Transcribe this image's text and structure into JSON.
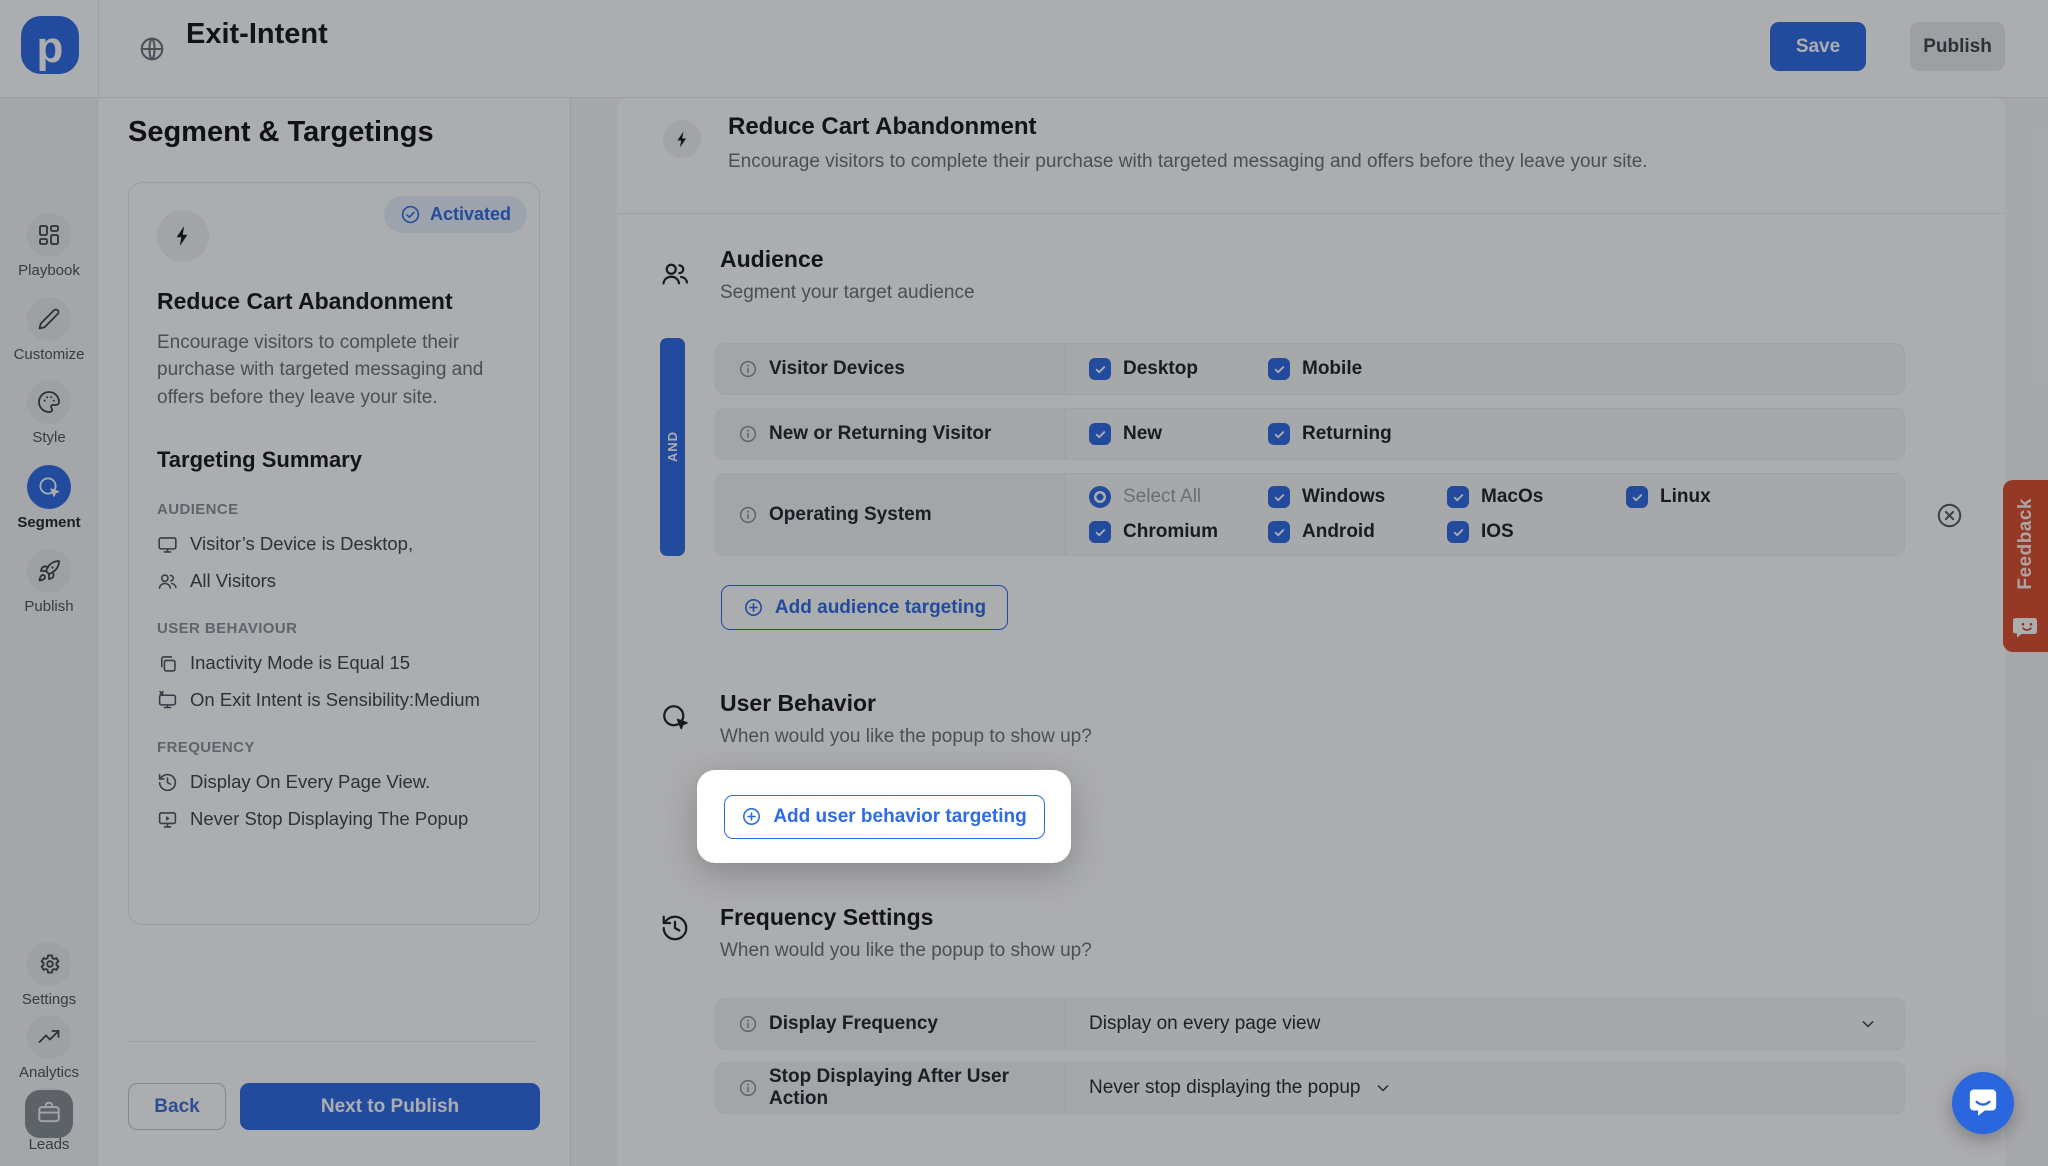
{
  "brand": {
    "logo_letter": "p"
  },
  "colors": {
    "accent": "#2E6BE5",
    "feedback_red": "#DE4E30",
    "page_bg": "#F7F8F9",
    "card_bg": "#FFFFFF"
  },
  "header": {
    "title": "Exit-Intent",
    "save_label": "Save",
    "publish_label": "Publish"
  },
  "sidebar": {
    "items": [
      {
        "label": "Playbook",
        "icon": "grid",
        "active": false
      },
      {
        "label": "Customize",
        "icon": "pencil",
        "active": false
      },
      {
        "label": "Style",
        "icon": "palette",
        "active": false
      },
      {
        "label": "Segment",
        "icon": "target",
        "active": true
      },
      {
        "label": "Publish",
        "icon": "rocket",
        "active": false
      },
      {
        "label": "Settings",
        "icon": "gear",
        "active": false
      },
      {
        "label": "Analytics",
        "icon": "trend",
        "active": false
      },
      {
        "label": "Leads",
        "icon": "users",
        "active": false
      }
    ]
  },
  "left_panel": {
    "title": "Segment & Targetings",
    "card": {
      "badge": "Activated",
      "title": "Reduce Cart Abandonment",
      "description": "Encourage visitors to complete their purchase with targeted messaging and offers before they leave your site.",
      "summary_title": "Targeting Summary",
      "sections": [
        {
          "label": "AUDIENCE",
          "items": [
            {
              "icon": "monitor",
              "text": "Visitor’s Device is Desktop,"
            },
            {
              "icon": "users",
              "text": "All Visitors"
            }
          ]
        },
        {
          "label": "USER BEHAVIOUR",
          "items": [
            {
              "icon": "copy",
              "text": "Inactivity Mode is Equal 15"
            },
            {
              "icon": "monitor-x",
              "text": "On Exit Intent is Sensibility:Medium"
            }
          ]
        },
        {
          "label": "FREQUENCY",
          "items": [
            {
              "icon": "history",
              "text": "Display On Every Page View."
            },
            {
              "icon": "monitor-play",
              "text": "Never Stop Displaying The Popup"
            }
          ]
        }
      ]
    },
    "back_label": "Back",
    "next_label": "Next to Publish"
  },
  "main": {
    "hero": {
      "title": "Reduce Cart Abandonment",
      "description": "Encourage visitors to complete their purchase with targeted messaging and offers before they leave your site."
    },
    "audience": {
      "title": "Audience",
      "subtitle": "Segment your target audience",
      "and_label": "AND",
      "add_button": "Add audience targeting",
      "rows": [
        {
          "label": "Visitor Devices",
          "tall": false,
          "option_lines": [
            [
              {
                "type": "checkbox",
                "checked": true,
                "label": "Desktop"
              },
              {
                "type": "checkbox",
                "checked": true,
                "label": "Mobile"
              }
            ]
          ]
        },
        {
          "label": "New or Returning Visitor",
          "tall": false,
          "option_lines": [
            [
              {
                "type": "checkbox",
                "checked": true,
                "label": "New"
              },
              {
                "type": "checkbox",
                "checked": true,
                "label": "Returning"
              }
            ]
          ]
        },
        {
          "label": "Operating System",
          "tall": true,
          "option_lines": [
            [
              {
                "type": "radio",
                "selected": true,
                "label": "Select All"
              },
              {
                "type": "checkbox",
                "checked": true,
                "label": "Windows"
              },
              {
                "type": "checkbox",
                "checked": true,
                "label": "MacOs"
              },
              {
                "type": "checkbox",
                "checked": true,
                "label": "Linux"
              }
            ],
            [
              {
                "type": "checkbox",
                "checked": true,
                "label": "Chromium"
              },
              {
                "type": "checkbox",
                "checked": true,
                "label": "Android"
              },
              {
                "type": "checkbox",
                "checked": true,
                "label": "IOS"
              }
            ]
          ]
        }
      ]
    },
    "user_behavior": {
      "title": "User Behavior",
      "subtitle": "When would you like the popup to show up?",
      "add_button": "Add user behavior targeting"
    },
    "frequency": {
      "title": "Frequency Settings",
      "subtitle": "When would you like the popup to show up?",
      "rows": [
        {
          "label": "Display Frequency",
          "value": "Display on every page view",
          "chevron": "end"
        },
        {
          "label": "Stop Displaying After User Action",
          "value": "Never stop displaying the popup",
          "chevron": "inline"
        }
      ]
    }
  },
  "feedback": {
    "label": "Feedback"
  }
}
